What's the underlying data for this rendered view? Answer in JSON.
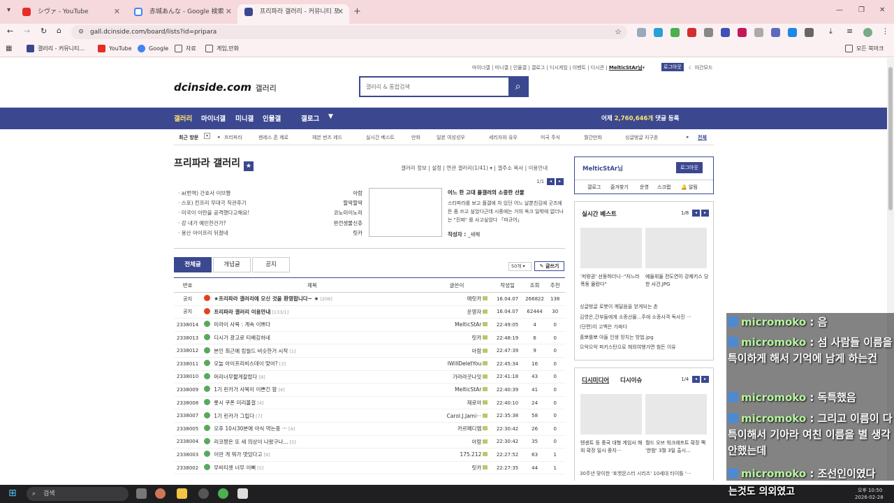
{
  "browser": {
    "tabs": [
      {
        "title": "シヴァ - YouTube",
        "active": false
      },
      {
        "title": "赤城あんな - Google 検索",
        "active": false
      },
      {
        "title": "프리파라 갤러리 - 커뮤니티 포",
        "active": true
      }
    ],
    "new_tab": "+",
    "url": "gall.dcinside.com/board/lists?id=pripara",
    "bookmarks": [
      "갤러리 - 커뮤니티...",
      "YouTube",
      "Google",
      "자료",
      "게임,만화"
    ],
    "all_bookmarks": "모든 북마크"
  },
  "site": {
    "logo": "dcinside.com",
    "logo_sub": "갤러리",
    "search_placeholder": "갤러리 & 통합검색",
    "top_links": [
      "마이너갤",
      "미니갤",
      "인물갤",
      "갤로그",
      "디시게임",
      "이벤트",
      "디시콘"
    ],
    "user_nick": "MelticStAr님",
    "logout": "로그아웃",
    "night_mode": "야간모드",
    "nav": [
      "갤러리",
      "마이너갤",
      "미니갤",
      "인물갤",
      "갤로그"
    ],
    "stat_prefix": "어제",
    "stat_value": "2,760,646개",
    "stat_suffix": "댓글 등록",
    "recent_label": "최근 방문",
    "recent": [
      "프리파라",
      "젠레스 존 제로",
      "헤븐 번즈 레드",
      "실시간 베스트",
      "만화",
      "일본 여성성우",
      "세리자와 유우",
      "미국 주식",
      "월간만화",
      "싱글벙글 지구촌"
    ],
    "recent_all": "전체"
  },
  "gallery": {
    "title": "프리파라 갤러리",
    "menu": [
      "갤러리 정보",
      "설정",
      "연관 갤러리(1/41)",
      "갤주소 복사",
      "이용안내"
    ],
    "page_indicator": "1/1",
    "trending": [
      {
        "title": "· a(번역) 간호사 이브쨩",
        "writer": "아람"
      },
      {
        "title": "· 스포) 킨프리 무대극 직관후기",
        "writer": "팔딱팔딱"
      },
      {
        "title": "· 미국이 이란을 공격했다고해요!",
        "writer": "코노미이노리"
      },
      {
        "title": "· 강 내가 예민한건가?",
        "writer": "완전생물신츄"
      },
      {
        "title": "· 용산 아이프리 뒤졌네",
        "writer": "릿카"
      }
    ],
    "feature_title": "어느 한 고대 플갤러의 소중한 선물",
    "feature_text": "스타파라를 보고 플갤에 차 있던 어느 날뿐친김에 굿즈에 돈 좀 쓰고 싶었다근데 시중에는 거의 옥크 일밖에 없더나는 \"진짜\" 를 사고싶었다 「피규어」",
    "feature_author_label": "작성자 :",
    "feature_author": "_새해",
    "tabs": [
      "전체글",
      "개념글",
      "공지"
    ],
    "per_page": "50개",
    "write_button": "글쓰기",
    "columns": [
      "번호",
      "제목",
      "글쓴이",
      "작성일",
      "조회",
      "추천"
    ],
    "posts": [
      {
        "no": "공지",
        "icon": "notice",
        "title": "★프리파라 갤러리에 오신 것을 환영합니다~ ★",
        "comments": "[206]",
        "writer": "애릿카",
        "date": "16.04.07",
        "views": "266822",
        "rec": "138",
        "bold": true
      },
      {
        "no": "공지",
        "icon": "notice",
        "title": "프리파라 갤러리 이용안내",
        "comments": "[133/1]",
        "writer": "운영자",
        "date": "16.04.07",
        "views": "62444",
        "rec": "30",
        "bold": true
      },
      {
        "no": "2338014",
        "icon": "post",
        "title": "미라이 사복 : 계속 이쁘다",
        "comments": "",
        "writer": "MelticStAr",
        "date": "22:49:05",
        "views": "4",
        "rec": "0",
        "bold": false
      },
      {
        "no": "2338013",
        "icon": "post",
        "title": "디시가 광고로 티배깅하네",
        "comments": "",
        "writer": "릿카",
        "date": "22:48:19",
        "views": "6",
        "rec": "0",
        "bold": false
      },
      {
        "no": "2338012",
        "icon": "post",
        "title": "본인 최근에 킹월드 비슷한거 시작",
        "comments": "[1]",
        "writer": "아람",
        "date": "22:47:39",
        "views": "9",
        "rec": "0",
        "bold": false
      },
      {
        "no": "2338011",
        "icon": "post",
        "title": "오늘 아이프리비스데이 맞아?",
        "comments": "[3]",
        "writer": "IWillDeletYou",
        "date": "22:45:34",
        "views": "16",
        "rec": "0",
        "bold": false
      },
      {
        "no": "2338010",
        "icon": "post",
        "title": "머리너무짧게잘랐다",
        "comments": "[9]",
        "writer": "가라라굿나잇",
        "date": "22:41:18",
        "views": "43",
        "rec": "0",
        "bold": false
      },
      {
        "no": "2338009",
        "icon": "post",
        "title": "1기 린카가 사복이 이쁜긴 함",
        "comments": "[4]",
        "writer": "MelticStAr",
        "date": "22:40:39",
        "views": "41",
        "rec": "0",
        "bold": false
      },
      {
        "no": "2338008",
        "icon": "post",
        "title": "롯시 쿠폰 미리볼걸",
        "comments": "[4]",
        "writer": "제로아",
        "date": "22:40:10",
        "views": "24",
        "rec": "0",
        "bold": false
      },
      {
        "no": "2338007",
        "icon": "post",
        "title": "1기 린카가 그립다",
        "comments": "[7]",
        "writer": "Carol.J.Jami···",
        "date": "22:35:38",
        "views": "58",
        "rec": "0",
        "bold": false
      },
      {
        "no": "2338005",
        "icon": "post",
        "title": "오후 10시30분에 야식 먹는중 ···",
        "comments": "[4]",
        "writer": "카르페디엠",
        "date": "22:30:42",
        "views": "26",
        "rec": "0",
        "bold": false
      },
      {
        "no": "2338004",
        "icon": "post",
        "title": "리코짱은 또 새 의상이 나왔구나...",
        "comments": "[5]",
        "writer": "아람",
        "date": "22:30:42",
        "views": "35",
        "rec": "0",
        "bold": false
      },
      {
        "no": "2338003",
        "icon": "post",
        "title": "이딴 게 뭐가 멋있다고",
        "comments": "[9]",
        "writer": "175.212",
        "date": "22:27:52",
        "views": "63",
        "rec": "1",
        "bold": false
      },
      {
        "no": "2338002",
        "icon": "post",
        "title": "무비티켓 너무 이뻐",
        "comments": "[5]",
        "writer": "릿카",
        "date": "22:27:35",
        "views": "44",
        "rec": "1",
        "bold": false
      }
    ]
  },
  "sidebar": {
    "nick": "MelticStAr님",
    "logout": "로그아웃",
    "menu": [
      "갤로그",
      "즐겨찾기",
      "운영",
      "스크랩",
      "알림"
    ],
    "best_title": "실시간 베스트",
    "best_page": "1/8",
    "best_captions": [
      "'저랑권' 선동하더니··\"자느라 폭동 몰랐다\"",
      "예들위들 전도연이 강제키스 당한 사건.JPG"
    ],
    "best_list": [
      "싱글벙글 로봇이 깨달음을 얻게되는 촌",
      "김영은,간부들에게 소종선물...주애 소종사격 독사진 ···",
      "(단편)이 고백은 가짜다",
      "홀뽀롤뽀 아들 인생 망치는 방법.jpg",
      "으악으악 파키스탄으로 해외여행가면 힘든 이유"
    ],
    "media_tabs": [
      "디시미디어",
      "디시이슈"
    ],
    "media_page": "1/4",
    "media_captions": [
      "텐센트 등 중국 대형 게임사 해외 확장 일시 중지···",
      "월드 오브 워크래프트 확장 팩 '한밤' 3월 3일 출시..."
    ],
    "media_more": "30주년 맞이한 '포켓몬스터 시리즈' 10세대 타이틀 '···"
  },
  "chat": [
    {
      "user": "micromoko",
      "text": "음"
    },
    {
      "user": "micromoko",
      "text": "섬 사람들 이름을 특이하게 해서 기억에 남게 하는건"
    },
    {
      "user": "micromoko",
      "text": "독특했음"
    },
    {
      "user": "micromoko",
      "text": "그리고 이름이 다 특이해서 기아라 여친 이름을 별 생각 안했는데"
    },
    {
      "user": "micromoko",
      "text": "조선인이였다"
    },
    {
      "user": "",
      "text": "는것도 의외였고"
    }
  ],
  "taskbar": {
    "search": "검색",
    "time": "오후 10:50",
    "date": "2026-02-28"
  }
}
